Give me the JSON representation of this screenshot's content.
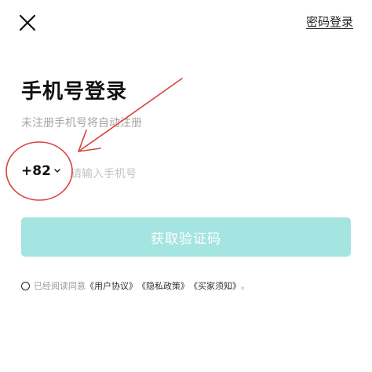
{
  "header": {
    "close_icon": "close-icon",
    "password_login_label": "密码登录"
  },
  "main": {
    "title": "手机号登录",
    "subtitle": "未注册手机号将自动注册",
    "country_code": "+82",
    "phone_placeholder": "请输入手机号",
    "phone_value": "",
    "get_code_button_label": "获取验证码"
  },
  "agreement": {
    "prefix": "已经阅读同意",
    "links": [
      "《用户协议》",
      "《隐私政策》",
      "《买家须知》"
    ],
    "suffix": "。"
  },
  "colors": {
    "button_background": "#a4e4e1",
    "annotation_red": "#d9433b"
  }
}
